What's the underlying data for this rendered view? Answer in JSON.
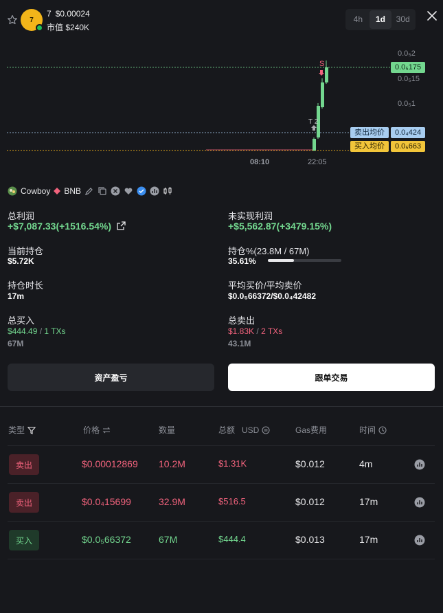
{
  "header": {
    "token_symbol": "7",
    "token_price": "$0.00024",
    "market_cap_label": "市值",
    "market_cap_value": "$240K",
    "avatar_text": "7",
    "timeframes": [
      "4h",
      "1d",
      "30d"
    ],
    "active_timeframe": "1d"
  },
  "chart": {
    "price_axis": [
      "0.0₅2",
      "0.0₅175",
      "0.0₅15",
      "0.0₅1",
      "0.0₄424",
      "0.0₅663"
    ],
    "current_price_tag": "0.0₅175",
    "sell_avg_label": "卖出均价",
    "sell_avg_value": "0.0₄424",
    "buy_avg_label": "买入均价",
    "buy_avg_value": "0.0₅663",
    "time_labels": [
      "08:10",
      "22:05"
    ],
    "marker_s": "S",
    "marker_t": "T 2",
    "colors": {
      "up": "#73d78f",
      "down": "#f2637d",
      "sell_line": "#a8cdf0",
      "buy_line": "#f2b51a"
    }
  },
  "trader": {
    "name": "Cowboy",
    "chain": "BNB"
  },
  "stats": {
    "total_profit_label": "总利润",
    "total_profit_value": "+$7,087.33(+1516.54%)",
    "unrealized_label": "未实现利润",
    "unrealized_value": "+$5,562.87(+3479.15%)",
    "holding_label": "当前持仓",
    "holding_value": "$5.72K",
    "holding_pct_label": "持仓%(23.8M / 67M)",
    "holding_pct_value": "35.61%",
    "holding_pct_fraction": 0.3561,
    "duration_label": "持仓时长",
    "duration_value": "17m",
    "avg_price_label": "平均买价/平均卖价",
    "avg_price_value": "$0.0₅66372/$0.0₄42482",
    "total_buy_label": "总买入",
    "total_buy_amount": "$444.49",
    "total_buy_sep": " / ",
    "total_buy_txs": "1 TXs",
    "total_buy_qty": "67M",
    "total_sell_label": "总卖出",
    "total_sell_amount": "$1.83K",
    "total_sell_sep": " / ",
    "total_sell_txs": "2 TXs",
    "total_sell_qty": "43.1M"
  },
  "actions": {
    "pnl_button": "资产盈亏",
    "copy_trade_button": "跟单交易"
  },
  "table": {
    "headers": {
      "type": "类型",
      "price": "价格",
      "qty": "数量",
      "total": "总额",
      "total_unit": "USD",
      "gas": "Gas费用",
      "time": "时间"
    },
    "rows": [
      {
        "type": "卖出",
        "side": "sell",
        "price": "$0.00012869",
        "qty": "10.2M",
        "total": "$1.31K",
        "gas": "$0.012",
        "time": "4m"
      },
      {
        "type": "卖出",
        "side": "sell",
        "price": "$0.0₄15699",
        "qty": "32.9M",
        "total": "$516.5",
        "gas": "$0.012",
        "time": "17m"
      },
      {
        "type": "买入",
        "side": "buy",
        "price": "$0.0₅66372",
        "qty": "67M",
        "total": "$444.4",
        "gas": "$0.013",
        "time": "17m"
      }
    ]
  }
}
